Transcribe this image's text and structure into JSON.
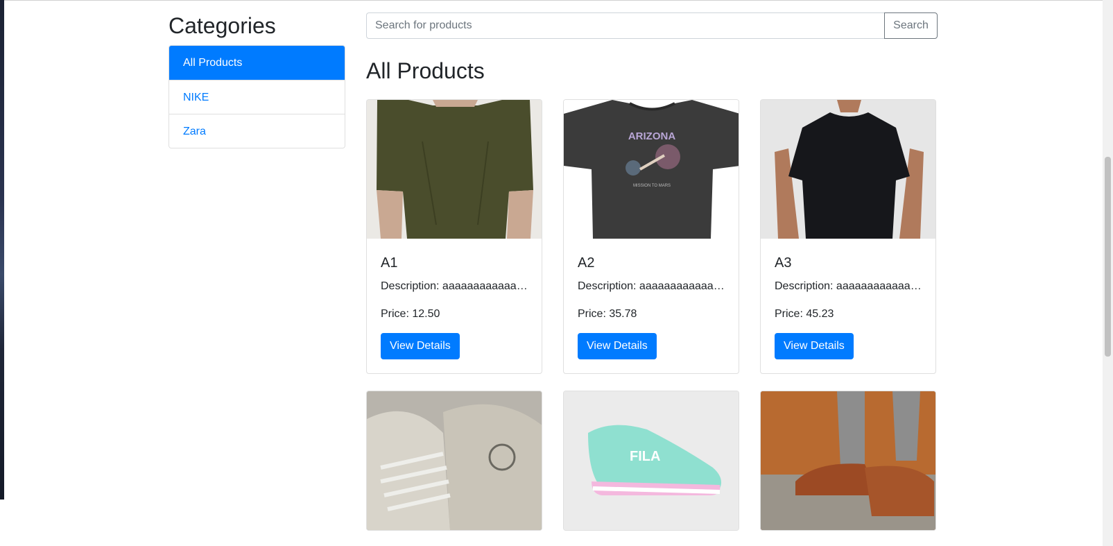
{
  "sidebar": {
    "title": "Categories",
    "items": [
      {
        "label": "All Products",
        "active": true
      },
      {
        "label": "NIKE",
        "active": false
      },
      {
        "label": "Zara",
        "active": false
      }
    ]
  },
  "search": {
    "placeholder": "Search for products",
    "value": "",
    "button_label": "Search"
  },
  "main": {
    "heading": "All Products"
  },
  "products": [
    {
      "name": "A1",
      "description": "Description: aaaaaaaaaaaaaaaaaaaa",
      "price": "Price: 12.50",
      "button": "View Details",
      "image": "olive-tshirt"
    },
    {
      "name": "A2",
      "description": "Description: aaaaaaaaaaaaaaaaaaaa",
      "price": "Price: 35.78",
      "button": "View Details",
      "image": "arizona-graphic-tshirt"
    },
    {
      "name": "A3",
      "description": "Description: aaaaaaaaaaaaaaaaaaaa",
      "price": "Price: 45.23",
      "button": "View Details",
      "image": "black-tshirt"
    },
    {
      "image": "reebok-sneakers"
    },
    {
      "image": "fila-running-shoe"
    },
    {
      "image": "brown-loafers"
    }
  ],
  "colors": {
    "primary": "#007bff",
    "text": "#212529",
    "border": "#dee2e6"
  }
}
